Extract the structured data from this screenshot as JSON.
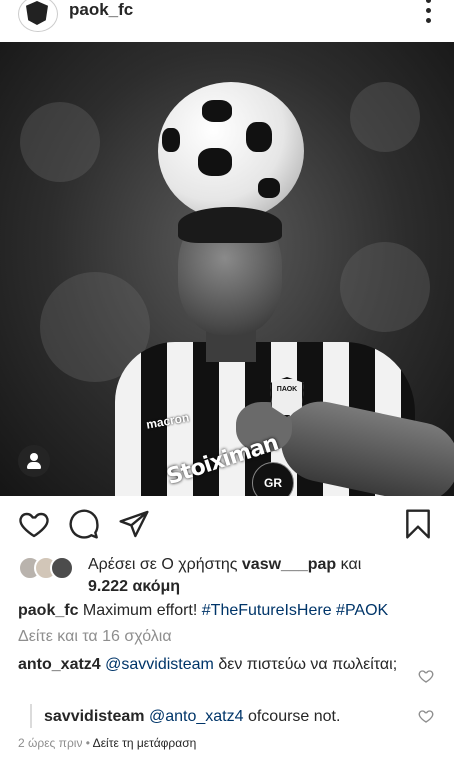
{
  "header": {
    "username": "paok_fc"
  },
  "post": {
    "sponsor_text": "Stoiximan",
    "brand_text": "macron",
    "gr_text": "GR",
    "badge_text": "ΠΑΟΚ"
  },
  "likes": {
    "prefix": "Αρέσει σε Ο χρήστης ",
    "user": "vasw___pap",
    "middle": " και",
    "count": "9.222 ακόμη"
  },
  "caption": {
    "username": "paok_fc",
    "text": " Maximum effort! ",
    "hashtags": "#TheFutureIsHere #PAOK"
  },
  "view_all_comments": "Δείτε και τα 16 σχόλια",
  "comments": [
    {
      "username": "anto_xatz4",
      "mention": "@savvidisteam",
      "text": " δεν πιστεύω να πωλείται;"
    },
    {
      "username": "savvidisteam",
      "mention": "@anto_xatz4",
      "text": " ofcourse not."
    }
  ],
  "timestamp": "2 ώρες πριν",
  "separator": " • ",
  "see_translation": "Δείτε τη μετάφραση",
  "icons": {
    "heart": "heart-icon",
    "comment": "comment-icon",
    "share": "share-icon",
    "save": "bookmark-icon",
    "more": "more-vertical-icon",
    "user_tag": "user-icon"
  }
}
